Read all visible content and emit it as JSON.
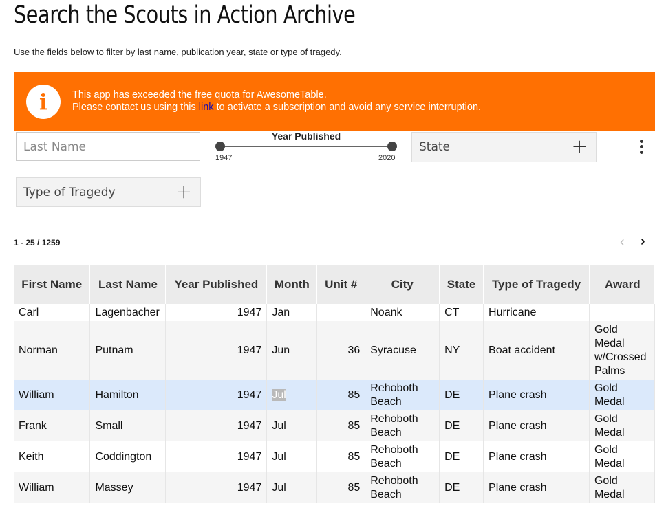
{
  "page": {
    "title": "Search the Scouts in Action Archive",
    "subtitle": "Use the fields below to filter by last name, publication year, state or type of tragedy."
  },
  "banner": {
    "icon": "info-icon",
    "glyph": "i",
    "line1": "This app has exceeded the free quota for AwesomeTable.",
    "line2_before": "Please contact us using this ",
    "link_text": "link",
    "line2_after": " to activate a subscription and avoid any service interruption.",
    "color": "#ff7002"
  },
  "filters": {
    "last_name_placeholder": "Last Name",
    "year_published": {
      "label": "Year Published",
      "min": "1947",
      "max": "2020"
    },
    "state_label": "State",
    "tragedy_label": "Type of Tragedy",
    "plus": "+"
  },
  "pagination": {
    "count": "1 - 25 / 1259",
    "prev": "‹",
    "next": "›"
  },
  "table": {
    "headers": {
      "first": "First Name",
      "last": "Last Name",
      "year": "Year Published",
      "month": "Month",
      "unit": "Unit #",
      "city": "City",
      "state": "State",
      "tragedy": "Type of Tragedy",
      "award": "Award"
    },
    "rows": [
      {
        "first": "Carl",
        "last": "Lagenbacher",
        "year": "1947",
        "month": "Jan",
        "unit": "",
        "city": "Noank",
        "state": "CT",
        "tragedy": "Hurricane",
        "award": ""
      },
      {
        "first": "Norman",
        "last": "Putnam",
        "year": "1947",
        "month": "Jun",
        "unit": "36",
        "city": "Syracuse",
        "state": "NY",
        "tragedy": "Boat accident",
        "award": "Gold Medal w/Crossed Palms"
      },
      {
        "first": "William",
        "last": "Hamilton",
        "year": "1947",
        "month": "Jul",
        "unit": "85",
        "city": "Rehoboth Beach",
        "state": "DE",
        "tragedy": "Plane crash",
        "award": "Gold Medal"
      },
      {
        "first": "Frank",
        "last": "Small",
        "year": "1947",
        "month": "Jul",
        "unit": "85",
        "city": "Rehoboth Beach",
        "state": "DE",
        "tragedy": "Plane crash",
        "award": "Gold Medal"
      },
      {
        "first": "Keith",
        "last": "Coddington",
        "year": "1947",
        "month": "Jul",
        "unit": "85",
        "city": "Rehoboth Beach",
        "state": "DE",
        "tragedy": "Plane crash",
        "award": "Gold Medal"
      },
      {
        "first": "William",
        "last": "Massey",
        "year": "1947",
        "month": "Jul",
        "unit": "85",
        "city": "Rehoboth Beach",
        "state": "DE",
        "tragedy": "Plane crash",
        "award": "Gold Medal"
      }
    ]
  }
}
